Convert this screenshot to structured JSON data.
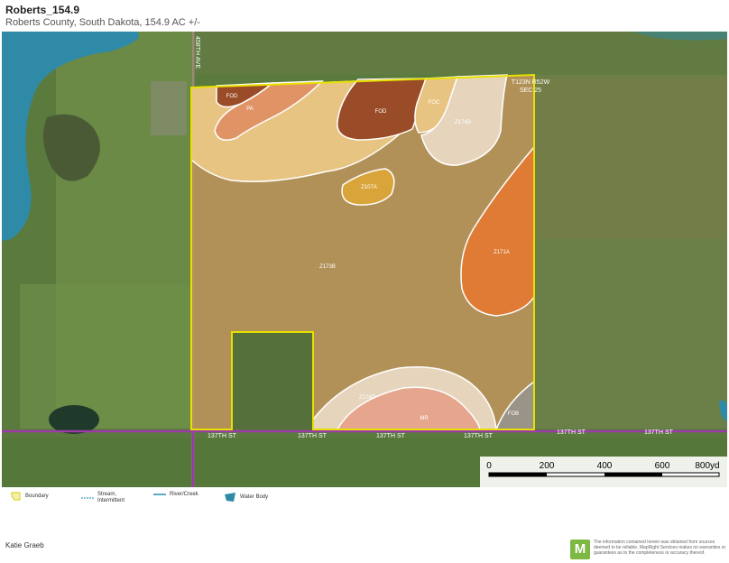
{
  "header": {
    "title": "Roberts_154.9",
    "subtitle": "Roberts County, South Dakota, 154.9 AC +/-"
  },
  "map": {
    "section_label_line1": "T123N R52W",
    "section_label_line2": "SEC 25",
    "road_labels": {
      "avenue": "458TH AVE",
      "street_1": "137TH ST",
      "street_2": "137TH ST",
      "street_3": "137TH ST",
      "street_4": "137TH ST",
      "street_5": "137TH ST",
      "street_6": "137TH ST"
    },
    "soil_labels": {
      "fod_nw": "FOD",
      "pa": "PA",
      "fod_n": "FOD",
      "foc": "FOC",
      "z174d_ne": "Z174D",
      "z107a": "Z107A",
      "z171a": "Z171A",
      "z173b": "Z173B",
      "z174d_s": "Z174D",
      "mr": "MR",
      "fob": "FOB"
    },
    "colors": {
      "boundary": "#e8e000",
      "z173b": "#b8925a",
      "light_tan": "#e8c483",
      "dark_brown": "#9a4b27",
      "salmon": "#e09466",
      "orange": "#df7b35",
      "beige": "#e6d5bc",
      "pink_mr": "#e6a68e",
      "gold": "#d9a53a",
      "road": "#9b3aa8",
      "water": "#2f8aa8"
    }
  },
  "scale": {
    "ticks": [
      "0",
      "200",
      "400",
      "600",
      "800yd"
    ]
  },
  "legend": {
    "boundary": "Boundary",
    "stream_line1": "Stream,",
    "stream_line2": "Intermittent",
    "river": "River/Creek",
    "water": "Water Body"
  },
  "footer": {
    "author": "Katie Graeb",
    "logo_letter": "M",
    "disclaimer": "The information contained herein was obtained from sources deemed to be reliable. MapRight Services makes no warranties or guarantees as to the completeness or accuracy thereof."
  }
}
